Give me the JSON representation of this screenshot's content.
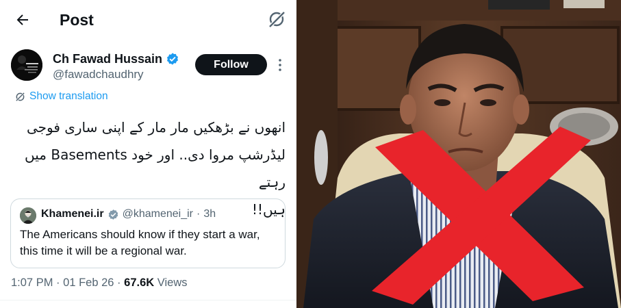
{
  "header": {
    "title": "Post",
    "back_icon": "back-arrow-icon",
    "grok_icon": "grok-icon"
  },
  "author": {
    "name": "Ch Fawad Hussain",
    "handle": "@fawadchaudhry",
    "verified": true,
    "verified_color": "#1d9bf0",
    "follow_label": "Follow"
  },
  "translate_label": "Show translation",
  "post_text": {
    "line1": "انھوں نے بڑھکیں مار مار کے اپنی ساری فوجی",
    "line2": "لیڈرشپ مروا دی.. اور خود Basements میں رہتے",
    "line3": "ہیں!!"
  },
  "quoted": {
    "name": "Khamenei.ir",
    "handle": "@khamenei_ir",
    "separator": "·",
    "time": "3h",
    "text": "The Americans should know if they start a war, this time it will be a regional war."
  },
  "meta": {
    "time": "1:07 PM",
    "separator": "·",
    "date": "01 Feb 26",
    "views_count": "67.6K",
    "views_label": "Views"
  },
  "photo": {
    "overlay_mark": "red-x",
    "overlay_color": "#e8242b"
  }
}
